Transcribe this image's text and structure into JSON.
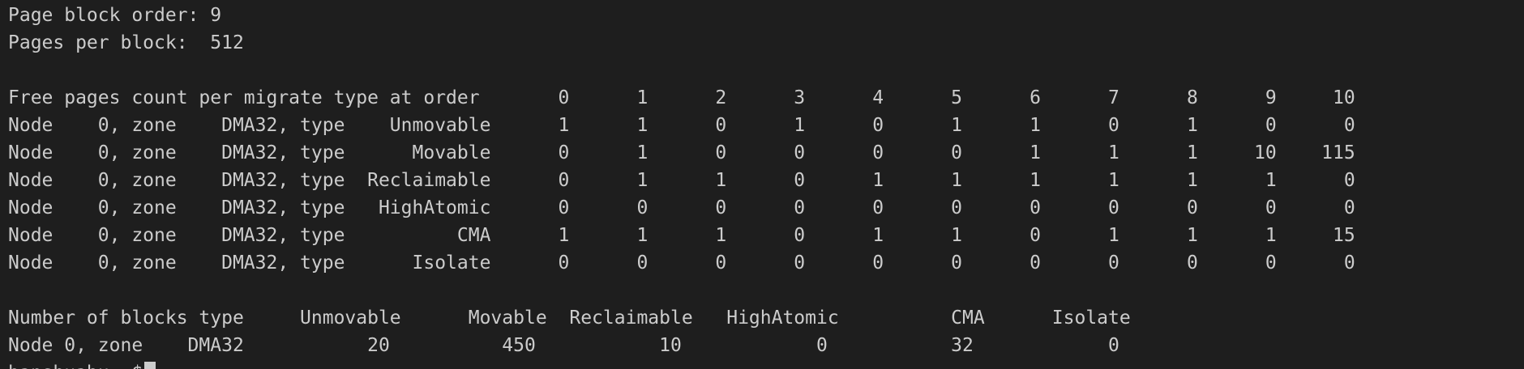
{
  "terminal": {
    "page_block_order": "Page block order: 9",
    "pages_per_block": "Pages per block:  512",
    "free_pages_header": "Free pages count per migrate type at order       0      1      2      3      4      5      6      7      8      9     10",
    "free_pages_rows": [
      "Node    0, zone    DMA32, type    Unmovable      1      1      0      1      0      1      1      0      1      0      0",
      "Node    0, zone    DMA32, type      Movable      0      1      0      0      0      0      1      1      1     10    115",
      "Node    0, zone    DMA32, type  Reclaimable      0      1      1      0      1      1      1      1      1      1      0",
      "Node    0, zone    DMA32, type   HighAtomic      0      0      0      0      0      0      0      0      0      0      0",
      "Node    0, zone    DMA32, type          CMA      1      1      1      0      1      1      0      1      1      1     15",
      "Node    0, zone    DMA32, type      Isolate      0      0      0      0      0      0      0      0      0      0      0"
    ],
    "blocks_header": "Number of blocks type     Unmovable      Movable  Reclaimable   HighAtomic          CMA      Isolate",
    "blocks_row": "Node 0, zone    DMA32           20          450           10            0           32            0",
    "prompt": "banshuabu:~$",
    "colors": {
      "background": "#1e1e1e",
      "foreground": "#cccccc",
      "cursor": "#cccccc"
    }
  }
}
